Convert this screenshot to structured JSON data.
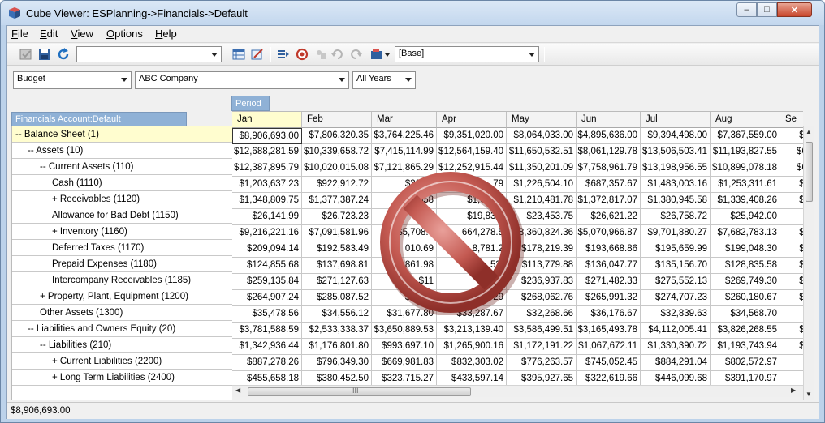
{
  "window": {
    "title": "Cube Viewer: ESPlanning->Financials->Default"
  },
  "menu": [
    "File",
    "Edit",
    "View",
    "Options",
    "Help"
  ],
  "menu_mnemonics": [
    "F",
    "E",
    "V",
    "O",
    "H"
  ],
  "toolbar": {
    "search_value": "",
    "view_combo": "[Base]"
  },
  "filters": {
    "scenario": "Budget",
    "entity": "ABC Company",
    "time": "All Years"
  },
  "grid": {
    "row_header": "Financials Account:Default",
    "column_dimension": "Period",
    "columns": [
      "Jan",
      "Feb",
      "Mar",
      "Apr",
      "May",
      "Jun",
      "Jul",
      "Aug",
      "Se"
    ],
    "rows": [
      {
        "label": "-- Balance Sheet (1)",
        "indent": 0,
        "values": [
          "$8,906,693.00",
          "$7,806,320.35",
          "$3,764,225.46",
          "$9,351,020.00",
          "$8,064,033.00",
          "$4,895,636.00",
          "$9,394,498.00",
          "$7,367,559.00",
          "$6"
        ]
      },
      {
        "label": "-- Assets (10)",
        "indent": 1,
        "values": [
          "$12,688,281.59",
          "$10,339,658.72",
          "$7,415,114.99",
          "$12,564,159.40",
          "$11,650,532.51",
          "$8,061,129.78",
          "$13,506,503.41",
          "$11,193,827.55",
          "$6,"
        ]
      },
      {
        "label": "-- Current Assets (110)",
        "indent": 2,
        "values": [
          "$12,387,895.79",
          "$10,020,015.08",
          "$7,121,865.29",
          "$12,252,915.44",
          "$11,350,201.09",
          "$7,758,961.79",
          "$13,198,956.55",
          "$10,899,078.18",
          "$6,"
        ]
      },
      {
        "label": "Cash (1110)",
        "indent": 3,
        "values": [
          "$1,203,637.23",
          "$922,912.72",
          "$309,3",
          "79",
          "$1,226,504.10",
          "$687,357.67",
          "$1,483,003.16",
          "$1,253,311.61",
          "$1"
        ]
      },
      {
        "label": "+ Receivables (1120)",
        "indent": 3,
        "values": [
          "$1,348,809.75",
          "$1,377,387.24",
          "$58",
          "$1,021,9",
          "$1,210,481.78",
          "$1,372,817.07",
          "$1,380,945.58",
          "$1,339,408.26",
          "$1"
        ]
      },
      {
        "label": "Allowance for Bad Debt (1150)",
        "indent": 3,
        "values": [
          "$26,141.99",
          "$26,723.23",
          "18",
          "$19,839.",
          "$23,453.75",
          "$26,621.22",
          "$26,758.72",
          "$25,942.00",
          ""
        ]
      },
      {
        "label": "+ Inventory (1160)",
        "indent": 3,
        "values": [
          "$9,216,221.16",
          "$7,091,581.96",
          "$5,708.7",
          "664,278.5",
          "$8,360,824.36",
          "$5,070,966.87",
          "$9,701,880.27",
          "$7,682,783.13",
          "$3"
        ]
      },
      {
        "label": "Deferred Taxes (1170)",
        "indent": 3,
        "values": [
          "$209,094.14",
          "$192,583.49",
          "010.69",
          "8,781.2",
          "$178,219.39",
          "$193,668.86",
          "$195,659.99",
          "$199,048.30",
          "$1"
        ]
      },
      {
        "label": "Prepaid Expenses (1180)",
        "indent": 3,
        "values": [
          "$124,855.68",
          "$137,698.81",
          "861.98",
          "53.",
          "$113,779.88",
          "$136,047.77",
          "$135,156.70",
          "$128,835.58",
          "$1"
        ]
      },
      {
        "label": "Intercompany Receivables (1185)",
        "indent": 3,
        "values": [
          "$259,135.84",
          "$271,127.63",
          "$11",
          "$189",
          "$236,937.83",
          "$271,482.33",
          "$275,552.13",
          "$269,749.30",
          "$1"
        ]
      },
      {
        "label": "+ Property, Plant, Equipment (1200)",
        "indent": 2,
        "values": [
          "$264,907.24",
          "$285,087.52",
          "$261,5",
          "29",
          "$268,062.76",
          "$265,991.32",
          "$274,707.23",
          "$260,180.67",
          "$1"
        ]
      },
      {
        "label": "Other Assets (1300)",
        "indent": 2,
        "values": [
          "$35,478.56",
          "$34,556.12",
          "$31,677.80",
          "$33,287.67",
          "$32,268.66",
          "$36,176.67",
          "$32,839.63",
          "$34,568.70",
          ""
        ]
      },
      {
        "label": "-- Liabilities and Owners Equity (20)",
        "indent": 1,
        "values": [
          "$3,781,588.59",
          "$2,533,338.37",
          "$3,650,889.53",
          "$3,213,139.40",
          "$3,586,499.51",
          "$3,165,493.78",
          "$4,112,005.41",
          "$3,826,268.55",
          "$2"
        ]
      },
      {
        "label": "-- Liabilities (210)",
        "indent": 2,
        "values": [
          "$1,342,936.44",
          "$1,176,801.80",
          "$993,697.10",
          "$1,265,900.16",
          "$1,172,191.22",
          "$1,067,672.11",
          "$1,330,390.72",
          "$1,193,743.94",
          "$1"
        ]
      },
      {
        "label": "+ Current Liabilities (2200)",
        "indent": 3,
        "values": [
          "$887,278.26",
          "$796,349.30",
          "$669,981.83",
          "$832,303.02",
          "$776,263.57",
          "$745,052.45",
          "$884,291.04",
          "$802,572.97",
          "$"
        ]
      },
      {
        "label": "+ Long Term Liabilities (2400)",
        "indent": 3,
        "values": [
          "$455,658.18",
          "$380,452.50",
          "$323,715.27",
          "$433,597.14",
          "$395,927.65",
          "$322,619.66",
          "$446,099.68",
          "$391,170.97",
          "$"
        ]
      }
    ]
  },
  "statusbar": {
    "value": "$8,906,693.00"
  },
  "hscroll_grip": "III",
  "colors": {
    "header_blue": "#8fb1d6",
    "selected_yellow": "#fffdcf",
    "nosign_red": "#c0392b"
  }
}
